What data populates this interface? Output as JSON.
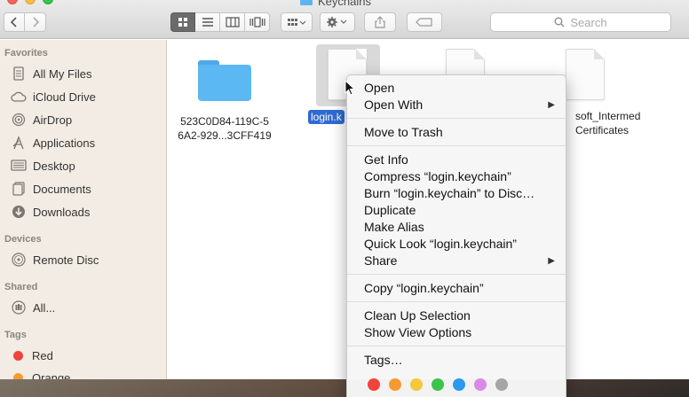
{
  "window": {
    "title": "Keychains"
  },
  "toolbar": {
    "search_placeholder": "Search"
  },
  "sidebar": {
    "favorites_heading": "Favorites",
    "favorites": [
      {
        "label": "All My Files",
        "icon": "all-files-icon"
      },
      {
        "label": "iCloud Drive",
        "icon": "cloud-icon"
      },
      {
        "label": "AirDrop",
        "icon": "airdrop-icon"
      },
      {
        "label": "Applications",
        "icon": "applications-icon"
      },
      {
        "label": "Desktop",
        "icon": "desktop-icon"
      },
      {
        "label": "Documents",
        "icon": "documents-icon"
      },
      {
        "label": "Downloads",
        "icon": "downloads-icon"
      }
    ],
    "devices_heading": "Devices",
    "devices": [
      {
        "label": "Remote Disc",
        "icon": "disc-icon"
      }
    ],
    "shared_heading": "Shared",
    "shared": [
      {
        "label": "All...",
        "icon": "network-icon"
      }
    ],
    "tags_heading": "Tags",
    "tags": [
      {
        "label": "Red",
        "color": "#f0433a"
      },
      {
        "label": "Orange",
        "color": "#f79a32"
      }
    ]
  },
  "files": {
    "folder_label_line1": "523C0D84-119C-5",
    "folder_label_line2": "6A2-929...3CFF419",
    "selected_label": "login.k",
    "partial_label_line1": "soft_Intermed",
    "partial_label_line2": "Certificates"
  },
  "context_menu": {
    "open": "Open",
    "open_with": "Open With",
    "move_to_trash": "Move to Trash",
    "get_info": "Get Info",
    "compress": "Compress “login.keychain”",
    "burn": "Burn “login.keychain” to Disc…",
    "duplicate": "Duplicate",
    "make_alias": "Make Alias",
    "quick_look": "Quick Look “login.keychain”",
    "share": "Share",
    "copy": "Copy “login.keychain”",
    "clean_up": "Clean Up Selection",
    "show_view_options": "Show View Options",
    "tags": "Tags…",
    "tag_colors": [
      "#f0433a",
      "#f79a32",
      "#f6c73a",
      "#3bc44b",
      "#2b99f0",
      "#d88ae6",
      "#a5a5a5"
    ]
  }
}
